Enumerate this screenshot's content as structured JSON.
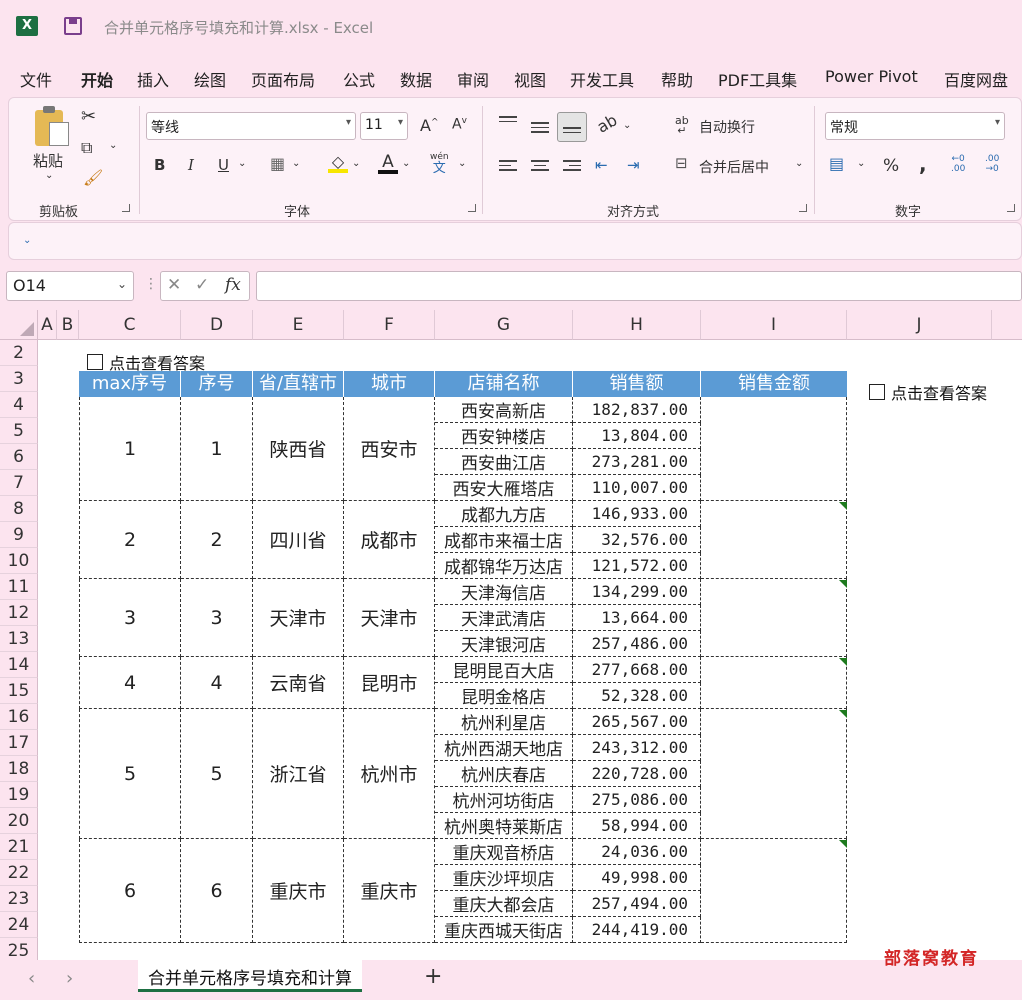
{
  "window": {
    "title": "合并单元格序号填充和计算.xlsx  -  Excel",
    "app_icon": "X"
  },
  "menu": [
    "文件",
    "开始",
    "插入",
    "绘图",
    "页面布局",
    "公式",
    "数据",
    "审阅",
    "视图",
    "开发工具",
    "帮助",
    "PDF工具集",
    "Power Pivot",
    "百度网盘"
  ],
  "ribbon": {
    "clipboard": {
      "paste": "粘贴",
      "label": "剪贴板"
    },
    "font": {
      "name": "等线",
      "size": "11",
      "bold": "B",
      "italic": "I",
      "underline": "U",
      "grow": "A",
      "shrink": "A",
      "color_a": "A",
      "phonetic": "wén",
      "phonetic2": "文",
      "label": "字体"
    },
    "align": {
      "wrap": "自动换行",
      "merge": "合并后居中",
      "label": "对齐方式"
    },
    "number": {
      "format": "常规",
      "percent": "%",
      "comma": ",",
      "label": "数字"
    }
  },
  "namebox": "O14",
  "fx": "fx",
  "columns": [
    "A",
    "B",
    "C",
    "D",
    "E",
    "F",
    "G",
    "H",
    "I",
    "J"
  ],
  "rows": [
    "2",
    "3",
    "4",
    "5",
    "6",
    "7",
    "8",
    "9",
    "10",
    "11",
    "12",
    "13",
    "14",
    "15",
    "16",
    "17",
    "18",
    "19",
    "20",
    "21",
    "22",
    "23",
    "24",
    "25"
  ],
  "checkbox_label": "点击查看答案",
  "table": {
    "headers": [
      "max序号",
      "序号",
      "省/直辖市",
      "城市",
      "店铺名称",
      "销售额",
      "销售金额"
    ],
    "groups": [
      {
        "max": "1",
        "seq": "1",
        "province": "陕西省",
        "city": "西安市",
        "stores": [
          {
            "name": "西安高新店",
            "amount": "182,837.00"
          },
          {
            "name": "西安钟楼店",
            "amount": "13,804.00"
          },
          {
            "name": "西安曲江店",
            "amount": "273,281.00"
          },
          {
            "name": "西安大雁塔店",
            "amount": "110,007.00"
          }
        ]
      },
      {
        "max": "2",
        "seq": "2",
        "province": "四川省",
        "city": "成都市",
        "stores": [
          {
            "name": "成都九方店",
            "amount": "146,933.00"
          },
          {
            "name": "成都市来福士店",
            "amount": "32,576.00"
          },
          {
            "name": "成都锦华万达店",
            "amount": "121,572.00"
          }
        ]
      },
      {
        "max": "3",
        "seq": "3",
        "province": "天津市",
        "city": "天津市",
        "stores": [
          {
            "name": "天津海信店",
            "amount": "134,299.00"
          },
          {
            "name": "天津武清店",
            "amount": "13,664.00"
          },
          {
            "name": "天津银河店",
            "amount": "257,486.00"
          }
        ]
      },
      {
        "max": "4",
        "seq": "4",
        "province": "云南省",
        "city": "昆明市",
        "stores": [
          {
            "name": "昆明昆百大店",
            "amount": "277,668.00"
          },
          {
            "name": "昆明金格店",
            "amount": "52,328.00"
          }
        ]
      },
      {
        "max": "5",
        "seq": "5",
        "province": "浙江省",
        "city": "杭州市",
        "stores": [
          {
            "name": "杭州利星店",
            "amount": "265,567.00"
          },
          {
            "name": "杭州西湖天地店",
            "amount": "243,312.00"
          },
          {
            "name": "杭州庆春店",
            "amount": "220,728.00"
          },
          {
            "name": "杭州河坊街店",
            "amount": "275,086.00"
          },
          {
            "name": "杭州奥特莱斯店",
            "amount": "58,994.00"
          }
        ]
      },
      {
        "max": "6",
        "seq": "6",
        "province": "重庆市",
        "city": "重庆市",
        "stores": [
          {
            "name": "重庆观音桥店",
            "amount": "24,036.00"
          },
          {
            "name": "重庆沙坪坝店",
            "amount": "49,998.00"
          },
          {
            "name": "重庆大都会店",
            "amount": "257,494.00"
          },
          {
            "name": "重庆西城天街店",
            "amount": "244,419.00"
          }
        ]
      }
    ]
  },
  "sheet_tab": "合并单元格序号填充和计算",
  "add_sheet": "+",
  "nav": {
    "prev": "‹",
    "next": "›"
  },
  "watermark": "部落窝教育"
}
